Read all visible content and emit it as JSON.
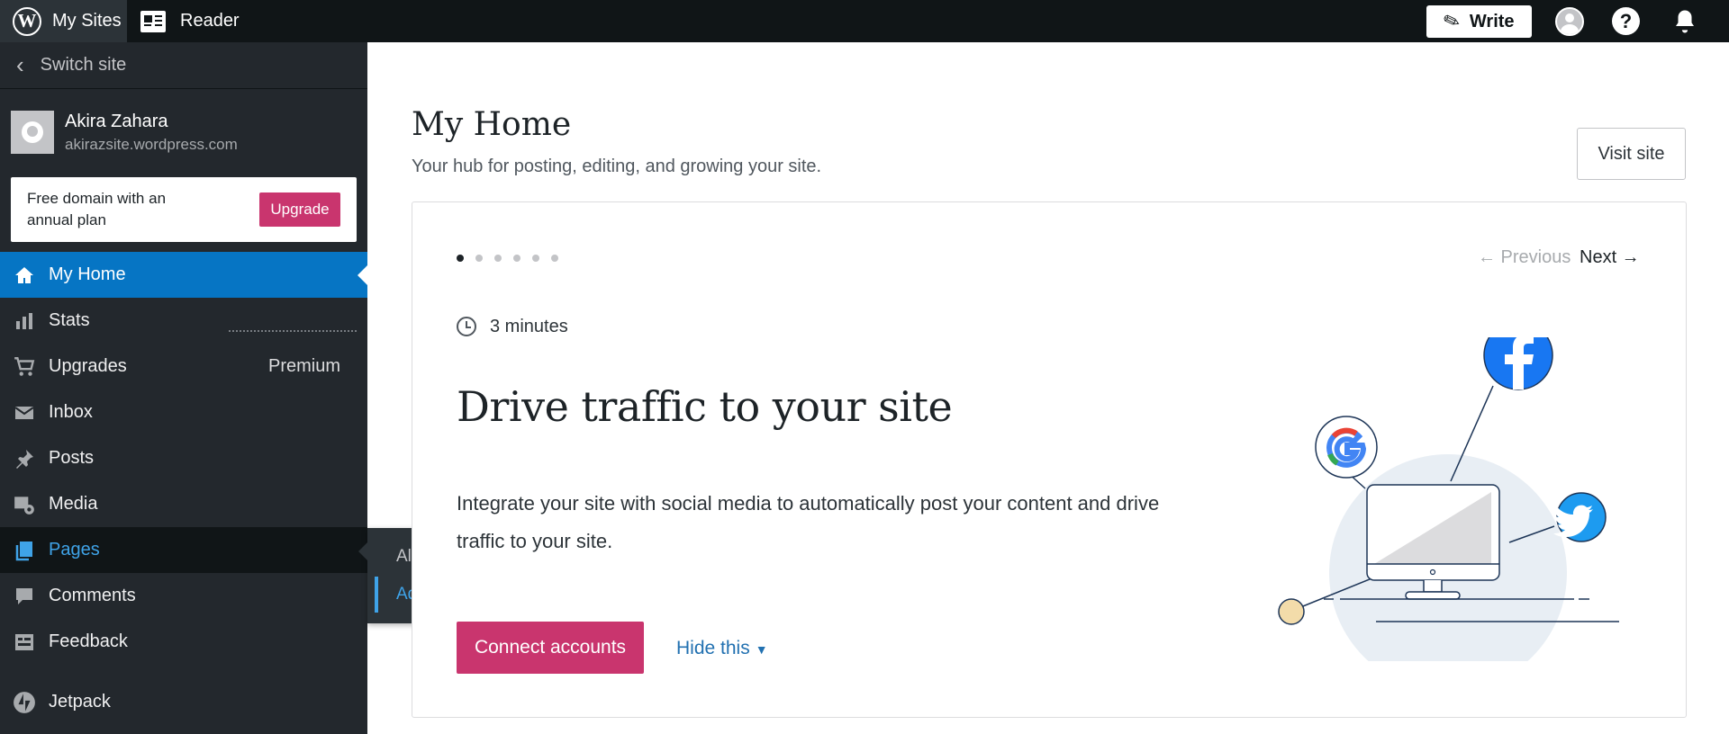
{
  "topbar": {
    "mysites_label": "My Sites",
    "reader_label": "Reader",
    "write_label": "Write"
  },
  "sidebar": {
    "switch_site": "Switch site",
    "site_name": "Akira Zahara",
    "site_url": "akirazsite.wordpress.com",
    "upsell_text": "Free domain with an annual plan",
    "upgrade_label": "Upgrade",
    "items": [
      {
        "label": "My Home",
        "icon": "home-icon"
      },
      {
        "label": "Stats",
        "icon": "stats-icon"
      },
      {
        "label": "Upgrades",
        "icon": "cart-icon",
        "badge": "Premium"
      },
      {
        "label": "Inbox",
        "icon": "mail-icon"
      },
      {
        "label": "Posts",
        "icon": "pin-icon"
      },
      {
        "label": "Media",
        "icon": "media-icon"
      },
      {
        "label": "Pages",
        "icon": "pages-icon"
      },
      {
        "label": "Comments",
        "icon": "comment-icon"
      },
      {
        "label": "Feedback",
        "icon": "feedback-icon"
      },
      {
        "label": "Jetpack",
        "icon": "jetpack-icon"
      }
    ],
    "flyout": {
      "all_pages": "All Pages",
      "add_new": "Add New"
    }
  },
  "main": {
    "title": "My Home",
    "subtitle": "Your hub for posting, editing, and growing your site.",
    "visit_site": "Visit site",
    "card": {
      "prev": "← Previous",
      "next": "Next →",
      "time": "3 minutes",
      "heading": "Drive traffic to your site",
      "description": "Integrate your site with social media to automatically post your content and drive traffic to your site.",
      "connect": "Connect accounts",
      "hide": "Hide this"
    }
  },
  "colors": {
    "accent": "#0675c4",
    "pink": "#c9356e",
    "sidebar": "#23282d"
  }
}
